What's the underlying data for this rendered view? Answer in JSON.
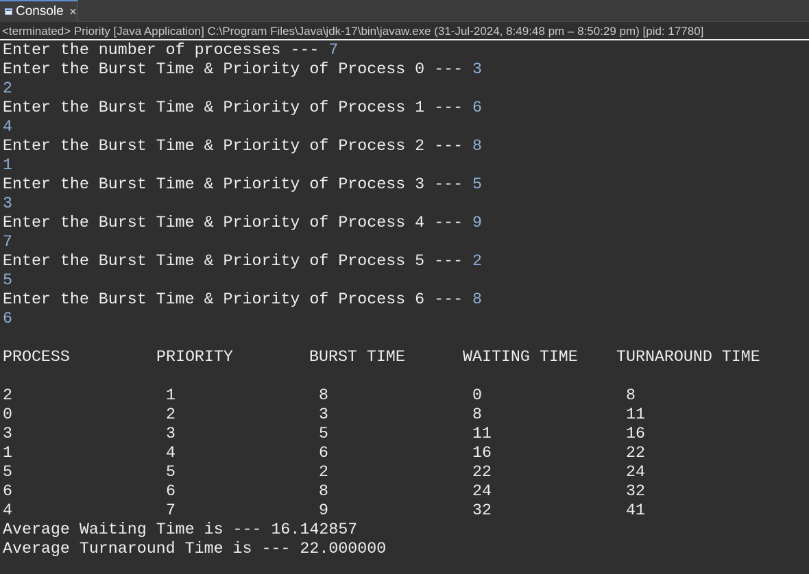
{
  "tab": {
    "label": "Console",
    "close_glyph": "✕",
    "icon": "console-icon"
  },
  "status": "<terminated> Priority [Java Application] C:\\Program Files\\Java\\jdk-17\\bin\\javaw.exe  (31-Jul-2024, 8:49:48 pm – 8:50:29 pm) [pid: 17780]",
  "prompts": {
    "num_processes": "Enter the number of processes --- ",
    "num_processes_input": "7",
    "entries": [
      {
        "prompt": "Enter the Burst Time & Priority of Process 0 --- ",
        "burst": "3",
        "priority": "2"
      },
      {
        "prompt": "Enter the Burst Time & Priority of Process 1 --- ",
        "burst": "6",
        "priority": "4"
      },
      {
        "prompt": "Enter the Burst Time & Priority of Process 2 --- ",
        "burst": "8",
        "priority": "1"
      },
      {
        "prompt": "Enter the Burst Time & Priority of Process 3 --- ",
        "burst": "5",
        "priority": "3"
      },
      {
        "prompt": "Enter the Burst Time & Priority of Process 4 --- ",
        "burst": "9",
        "priority": "7"
      },
      {
        "prompt": "Enter the Burst Time & Priority of Process 5 --- ",
        "burst": "2",
        "priority": "5"
      },
      {
        "prompt": "Enter the Burst Time & Priority of Process 6 --- ",
        "burst": "8",
        "priority": "6"
      }
    ]
  },
  "table": {
    "headers": [
      "PROCESS",
      "PRIORITY",
      "BURST TIME",
      "WAITING TIME",
      "TURNAROUND TIME"
    ],
    "rows": [
      [
        "2",
        "1",
        "8",
        "0",
        "8"
      ],
      [
        "0",
        "2",
        "3",
        "8",
        "11"
      ],
      [
        "3",
        "3",
        "5",
        "11",
        "16"
      ],
      [
        "1",
        "4",
        "6",
        "16",
        "22"
      ],
      [
        "5",
        "5",
        "2",
        "22",
        "24"
      ],
      [
        "6",
        "6",
        "8",
        "24",
        "32"
      ],
      [
        "4",
        "7",
        "9",
        "32",
        "41"
      ]
    ]
  },
  "averages": {
    "waiting": "Average Waiting Time is --- 16.142857",
    "turnaround": "Average Turnaround Time is --- 22.000000"
  },
  "colors": {
    "background": "#2f2f2f",
    "output_text": "#eeeeee",
    "input_text": "#8fb0d6"
  }
}
